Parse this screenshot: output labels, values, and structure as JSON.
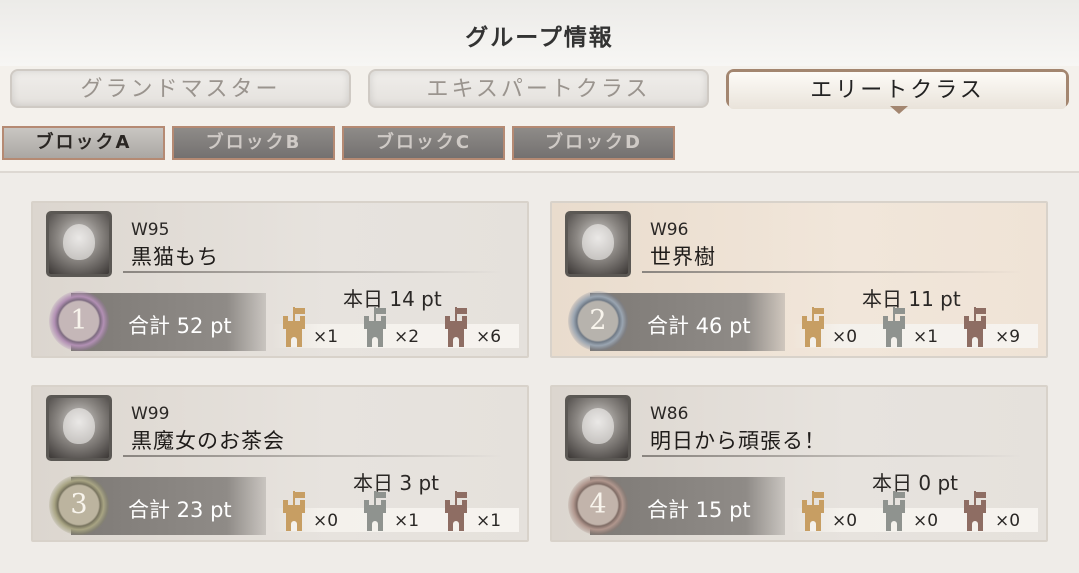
{
  "header": {
    "title": "グループ情報"
  },
  "tiers": [
    {
      "label": "グランドマスター",
      "active": false
    },
    {
      "label": "エキスパートクラス",
      "active": false
    },
    {
      "label": "エリートクラス",
      "active": true
    }
  ],
  "blocks": [
    {
      "label": "ブロックA",
      "active": true
    },
    {
      "label": "ブロックB",
      "active": false
    },
    {
      "label": "ブロックC",
      "active": false
    },
    {
      "label": "ブロックD",
      "active": false
    }
  ],
  "players": [
    {
      "rank": "1",
      "code": "W95",
      "name": "黒猫もち",
      "total": "合計 52 pt",
      "today": "本日 14 pt",
      "towers": {
        "gold": "×1",
        "silver": "×2",
        "bronze": "×6"
      },
      "badge_color": "purple",
      "highlighted": false
    },
    {
      "rank": "2",
      "code": "W96",
      "name": "世界樹",
      "total": "合計 46 pt",
      "today": "本日 11 pt",
      "towers": {
        "gold": "×0",
        "silver": "×1",
        "bronze": "×9"
      },
      "badge_color": "blue",
      "highlighted": true
    },
    {
      "rank": "3",
      "code": "W99",
      "name": "黒魔女のお茶会",
      "total": "合計 23 pt",
      "today": "本日 3 pt",
      "towers": {
        "gold": "×0",
        "silver": "×1",
        "bronze": "×1"
      },
      "badge_color": "green",
      "highlighted": false
    },
    {
      "rank": "4",
      "code": "W86",
      "name": "明日から頑張る！",
      "total": "合計 15 pt",
      "today": "本日 0 pt",
      "towers": {
        "gold": "×0",
        "silver": "×0",
        "bronze": "×0"
      },
      "badge_color": "rose",
      "highlighted": false
    }
  ],
  "tower_icons": [
    "gold-tower-icon",
    "silver-tower-icon",
    "bronze-tower-icon"
  ]
}
